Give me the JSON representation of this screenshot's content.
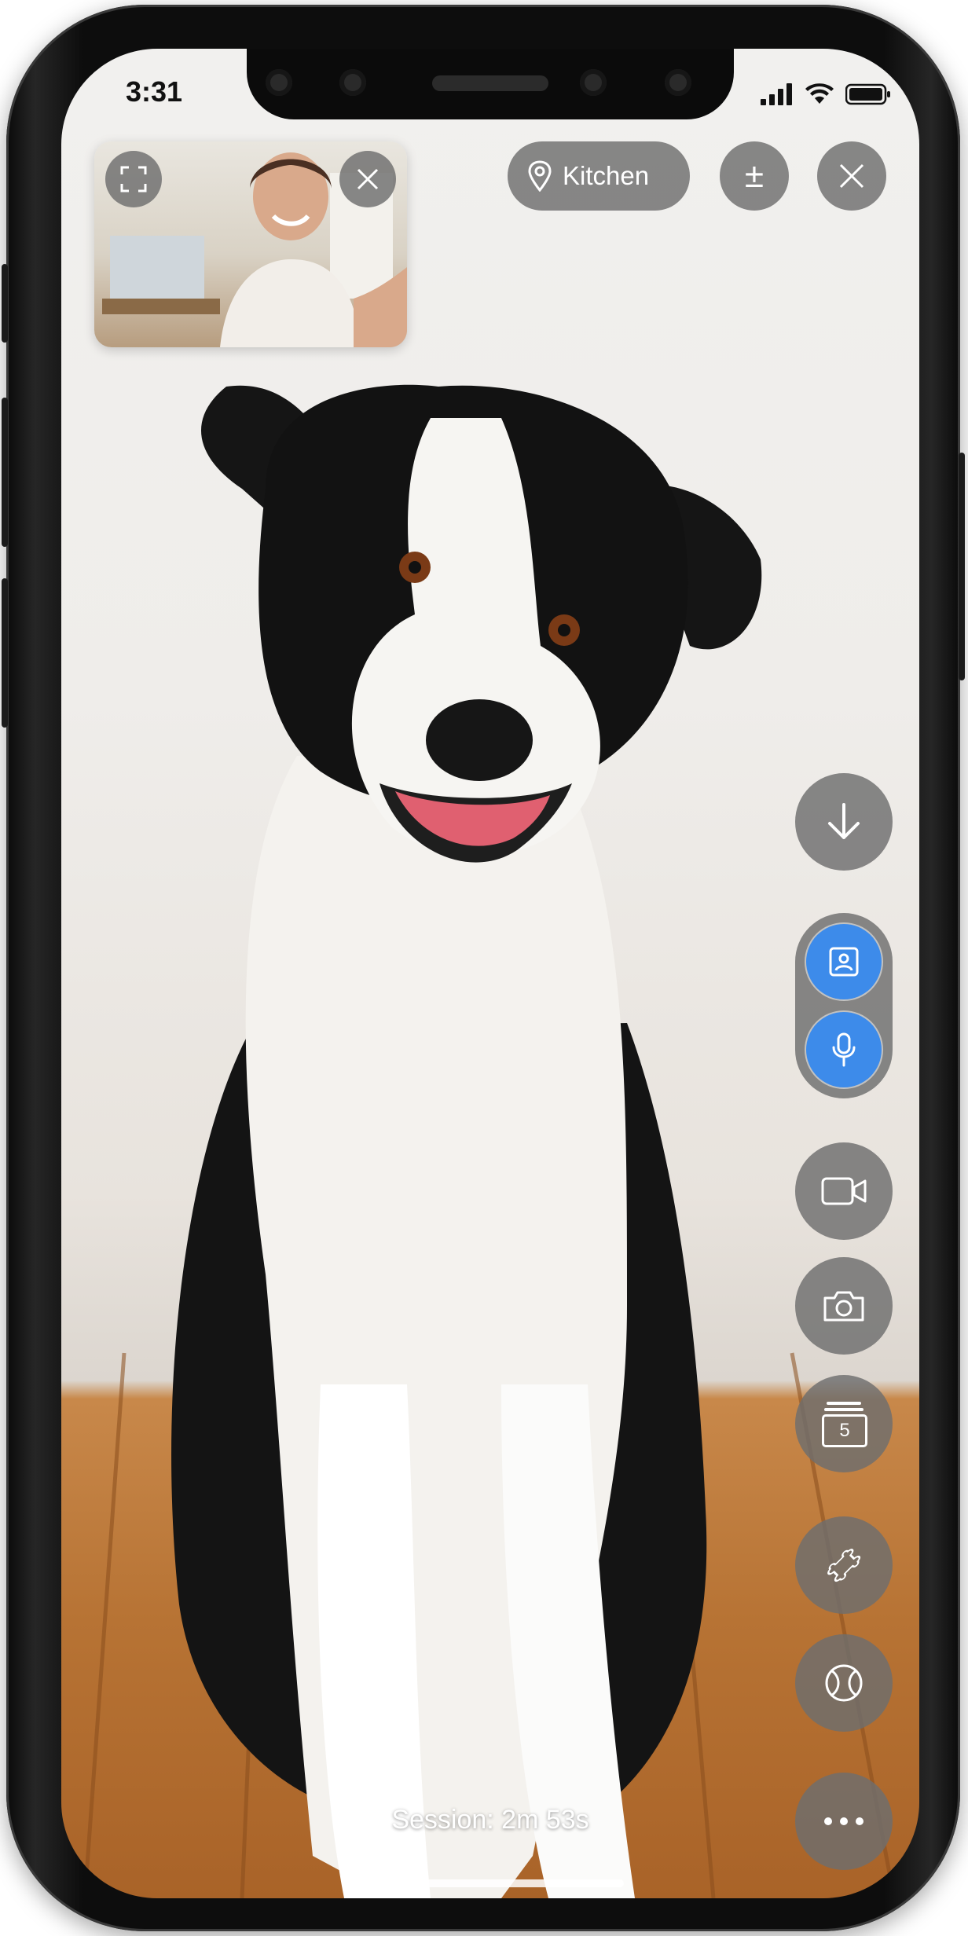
{
  "status_bar": {
    "time": "3:31"
  },
  "pip_video": {
    "fullscreen_icon": "fullscreen-icon",
    "close_icon": "close-icon"
  },
  "top_controls": {
    "location_label": "Kitchen",
    "location_icon": "map-pin-icon",
    "plus_minus_label": "±",
    "close_icon": "close-icon"
  },
  "side_controls": {
    "download_icon": "arrow-down-icon",
    "camera_switch_icon": "contact-card-icon",
    "microphone_icon": "microphone-icon",
    "video_icon": "video-camera-icon",
    "photo_icon": "camera-icon",
    "treats_count": "5",
    "treat_icon": "bone-icon",
    "ball_icon": "ball-icon",
    "more_icon": "more-icon"
  },
  "session": {
    "label": "Session: 2m 53s"
  },
  "colors": {
    "accent": "#3d8bea",
    "control_bg": "#6e6e6e"
  }
}
